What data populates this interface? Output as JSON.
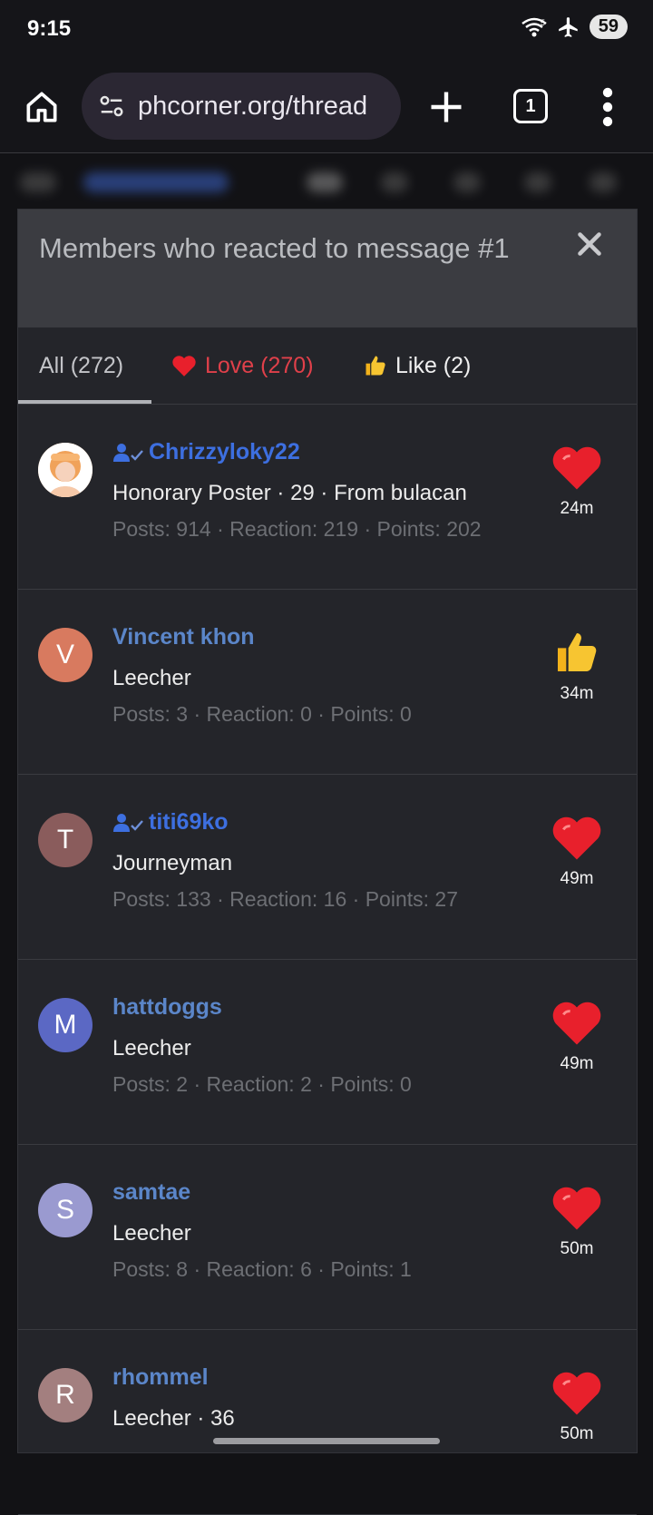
{
  "status_bar": {
    "time": "9:15",
    "battery": "59",
    "wifi_label": "5"
  },
  "browser": {
    "url": "phcorner.org/thread",
    "tab_count": "1"
  },
  "dialog": {
    "title": "Members who reacted to message #1",
    "tabs": [
      {
        "label": "All (272)"
      },
      {
        "label": "Love (270)"
      },
      {
        "label": "Like (2)"
      }
    ]
  },
  "members": [
    {
      "name": "Chrizzyloky22",
      "verified": true,
      "title": "Honorary Poster · 29 · From bulacan",
      "stats": "Posts: 914 · Reaction: 219 · Points: 202",
      "reaction": "heart-icon",
      "time": "24m",
      "avatar_letter": "",
      "avatar_color": "#f0a25a"
    },
    {
      "name": "Vincent khon",
      "verified": false,
      "title": "Leecher",
      "stats": "Posts: 3 · Reaction: 0 · Points: 0",
      "reaction": "thumbs-up-icon",
      "time": "34m",
      "avatar_letter": "V",
      "avatar_color": "#d87a5f"
    },
    {
      "name": "titi69ko",
      "verified": true,
      "title": "Journeyman",
      "stats": "Posts: 133 · Reaction: 16 · Points: 27",
      "reaction": "heart-icon",
      "time": "49m",
      "avatar_letter": "T",
      "avatar_color": "#8a5c5c"
    },
    {
      "name": "hattdoggs",
      "verified": false,
      "title": "Leecher",
      "stats": "Posts: 2 · Reaction: 2 · Points: 0",
      "reaction": "heart-icon",
      "time": "49m",
      "avatar_letter": "M",
      "avatar_color": "#5b68c4"
    },
    {
      "name": "samtae",
      "verified": false,
      "title": "Leecher",
      "stats": "Posts: 8 · Reaction: 6 · Points: 1",
      "reaction": "heart-icon",
      "time": "50m",
      "avatar_letter": "S",
      "avatar_color": "#9a9ad0"
    },
    {
      "name": "rhommel",
      "verified": false,
      "title": "Leecher · 36",
      "stats": "",
      "reaction": "heart-icon",
      "time": "50m",
      "avatar_letter": "R",
      "avatar_color": "#a37f7f"
    }
  ]
}
